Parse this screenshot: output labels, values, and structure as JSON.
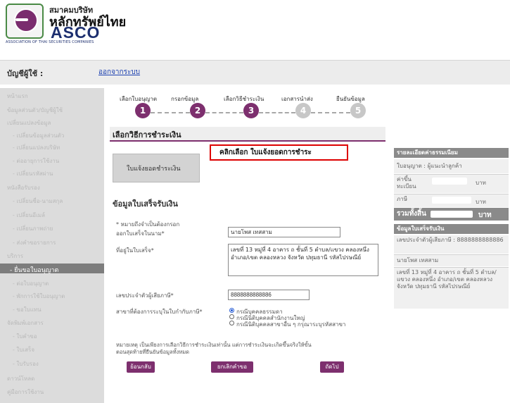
{
  "brand": {
    "name_th_small": "สมาคมบริษัท",
    "name_th": "หลักทรัพย์ไทย",
    "abbr": "ASCO",
    "name_en": "ASSOCIATION OF THAI SECURITIES COMPANIES"
  },
  "account": {
    "label": "บัญชีผู้ใช้ :",
    "logout": "ออกจากระบบ"
  },
  "sidebar": {
    "items": [
      "หน้าแรก",
      "ข้อมูลส่วนตัว/บัญชีผู้ใช้",
      "เปลี่ยนแปลงข้อมูล",
      "- เปลี่ยนข้อมูลส่วนตัว",
      "- เปลี่ยนแปลงบริษัท",
      "- ต่ออายุการใช้งาน",
      "- เปลี่ยนรหัสผ่าน",
      "หนังสือรับรอง",
      "- เปลี่ยนชื่อ-นามสกุล",
      "- เปลี่ยนอีเมล์",
      "- เปลี่ยนภาพถ่าย",
      "- ส่งคำขอรายการ",
      "บริการ",
      "- ยื่นขอใบอนุญาต",
      "- ต่อใบอนุญาต",
      "- พักการใช้ใบอนุญาต",
      "- ขอใบแทน",
      "จัดพิมพ์เอกสาร",
      "- ใบคำขอ",
      "- ใบเสร็จ",
      "- ใบรับรอง",
      "ดาวน์โหลด",
      "คู่มือการใช้งาน"
    ],
    "active": "- ยื่นขอใบอนุญาต"
  },
  "steps": [
    {
      "num": "1",
      "label": "เลือกใบอนุญาต",
      "state": "on"
    },
    {
      "num": "2",
      "label": "กรอกข้อมูล",
      "state": "on"
    },
    {
      "num": "3",
      "label": "เลือกวิธีชำระเงิน",
      "state": "on"
    },
    {
      "num": "4",
      "label": "เอกสารนำส่ง",
      "state": "off"
    },
    {
      "num": "5",
      "label": "ยืนยันข้อมูล",
      "state": "off"
    }
  ],
  "section_title": "เลือกวิธีการชำระเงิน",
  "hint": "คลิกเลือก ใบแจ้งยอดการชำระ",
  "payment_method": "ใบแจ้งยอดชำระเงิน",
  "form": {
    "title": "ข้อมูลใบเสร็จรับเงิน",
    "required_note": "* หมายถึงจำเป็นต้องกรอก",
    "name_label": "ออกใบเสร็จในนาม*",
    "name_value": "นายโพส เทสสาม",
    "address_label": "ที่อยู่ในใบเสร็จ*",
    "address_value": "เลขที่ 13 หมู่ที่ 4 อาคาร ถ ชั้นที่ 5 ตำบล/แขวง คลองหนึ่ง อำเภอ/เขต คลองหลวง จังหวัด ปทุมธานี รหัสไปรษณีย์",
    "taxid_label": "เลขประจำตัวผู้เสียภาษี*",
    "taxid_value": "8888888888886",
    "branch_label": "สาขาที่ต้องการระบุในใบกำกับภาษี*",
    "branch_options": [
      {
        "label": "กรณีบุคคลธรรมดา",
        "selected": true
      },
      {
        "label": "กรณีนิติบุคคลสำนักงานใหญ่",
        "selected": false
      },
      {
        "label": "กรณีนิติบุคคลสาขาอื่น ๆ กรุณาระบุรหัสสาขา",
        "selected": false
      }
    ],
    "remark": "หมายเหตุ เป็นเพียงการเลือกวิธีการชำระเงินเท่านั้น แต่การชำระเงินจะเกิดขึ้นจริงให้ขั้นตอนสุดท้ายที่ยืนยันข้อมูลทั้งหมด"
  },
  "buttons": {
    "back": "ย้อนกลับ",
    "cancel": "ยกเลิกคำขอ",
    "next": "ถัดไป"
  },
  "fees": {
    "header": "รายละเอียดค่าธรรมเนียม",
    "license": "ใบอนุญาต : ผู้แนะนำลูกค้า",
    "registration_label": "ค่าขึ้นทะเบียน",
    "registration_unit": "บาท",
    "tax_label": "ภาษี",
    "tax_unit": "บาท",
    "total_label": "รวมทั้งสิ้น",
    "total_unit": "บาท"
  },
  "receipt": {
    "header": "ข้อมูลใบเสร็จรับเงิน",
    "taxid": "เลขประจำตัวผู้เสียภาษี : 8888888888886",
    "name": "นายโพส เทสสาม",
    "address": "เลขที่ 13 หมู่ที่ 4 อาคาร ถ ชั้นที่ 5 ตำบล/แขวง คลองหนึ่ง อำเภอ/เขต คลองหลวง จังหวัด ปทุมธานี รหัสไปรษณีย์"
  },
  "colors": {
    "brand_purple": "#7d2f6e",
    "highlight_red": "#dd0000",
    "link_blue": "#1a3fb0"
  }
}
